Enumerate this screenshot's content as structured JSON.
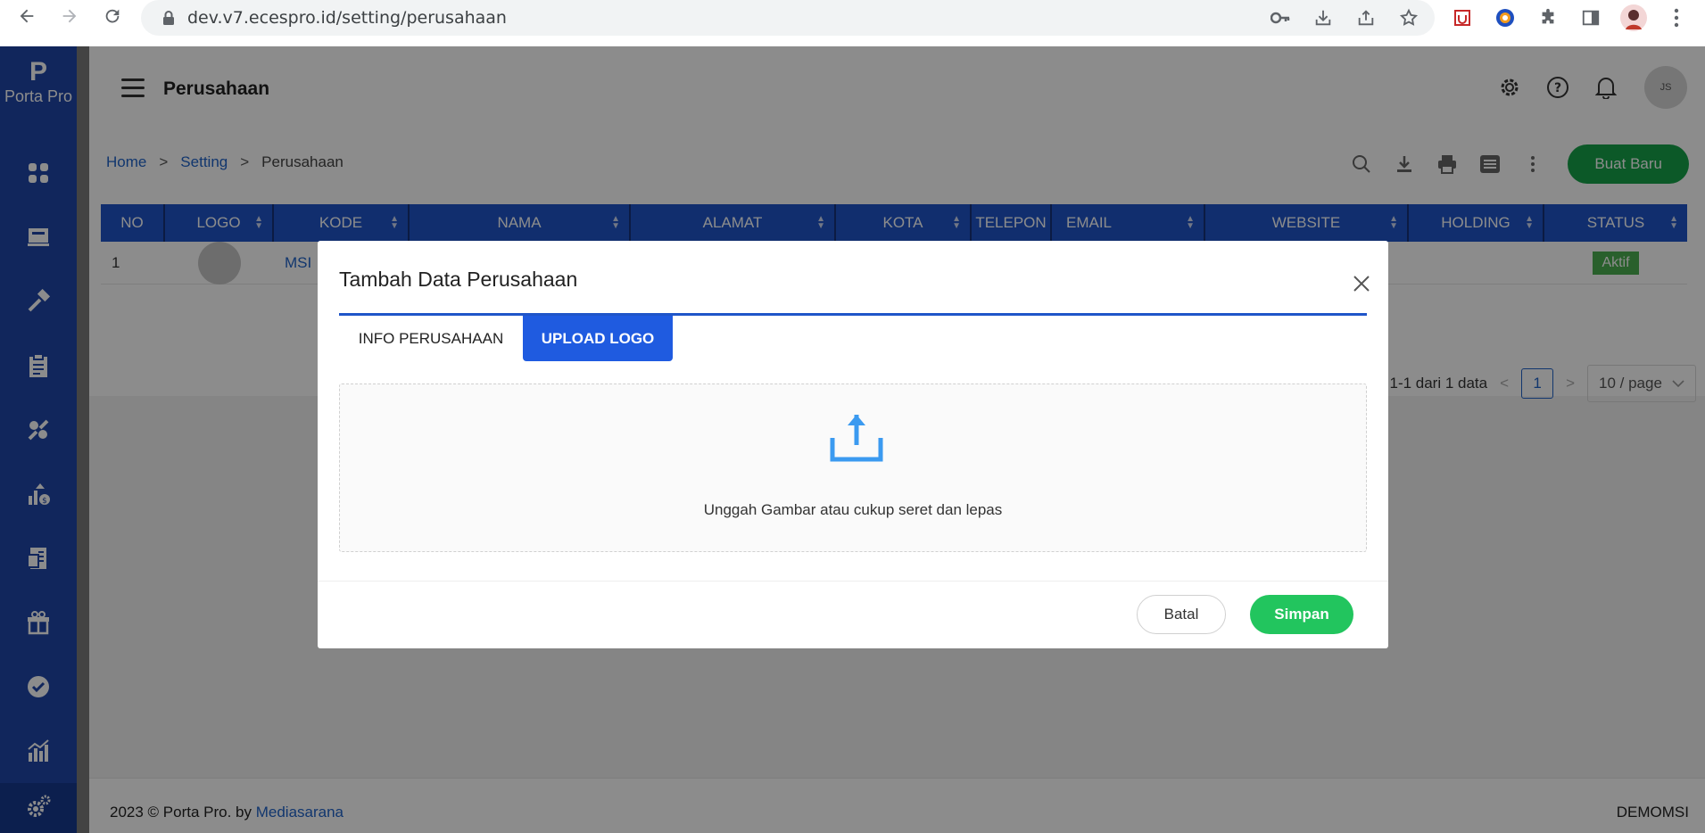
{
  "browser": {
    "url": "dev.v7.ecespro.id/setting/perusahaan"
  },
  "sidebar": {
    "logo_mark": "P",
    "logo_name": "Porta Pro",
    "items": [
      {
        "icon": "dashboard-icon"
      },
      {
        "icon": "warehouse-icon"
      },
      {
        "icon": "hammer-icon"
      },
      {
        "icon": "clipboard-icon"
      },
      {
        "icon": "tools-icon"
      },
      {
        "icon": "finance-chart-icon"
      },
      {
        "icon": "invoice-icon"
      },
      {
        "icon": "gift-icon"
      },
      {
        "icon": "badge-check-icon"
      },
      {
        "icon": "bar-chart-icon"
      },
      {
        "icon": "settings-gear-icon"
      }
    ]
  },
  "header": {
    "title": "Perusahaan",
    "avatar_initials": "JS"
  },
  "breadcrumb": {
    "home": "Home",
    "sep": ">",
    "setting": "Setting",
    "current": "Perusahaan"
  },
  "toolbar": {
    "new_button": "Buat Baru"
  },
  "table": {
    "columns": [
      "NO",
      "LOGO",
      "KODE",
      "NAMA",
      "ALAMAT",
      "KOTA",
      "TELEPON",
      "EMAIL",
      "WEBSITE",
      "HOLDING",
      "STATUS"
    ],
    "rows": [
      {
        "no": "1",
        "kode": "MSI",
        "status": "Aktif"
      }
    ]
  },
  "pagination": {
    "summary": "1-1 dari 1 data",
    "current_page": "1",
    "page_size": "10 / page"
  },
  "footer": {
    "copyright": "2023 © Porta Pro. by ",
    "company_link": "Mediasarana",
    "tenant": "DEMOMSI"
  },
  "modal": {
    "title": "Tambah Data Perusahaan",
    "tabs": [
      "INFO PERUSAHAAN",
      "UPLOAD LOGO"
    ],
    "active_tab": "UPLOAD LOGO",
    "upload_hint": "Unggah Gambar atau cukup seret dan lepas",
    "cancel": "Batal",
    "save": "Simpan"
  },
  "colors": {
    "sidebar": "#1f46a8",
    "primary": "#1f55c9",
    "success": "#22c55e"
  }
}
